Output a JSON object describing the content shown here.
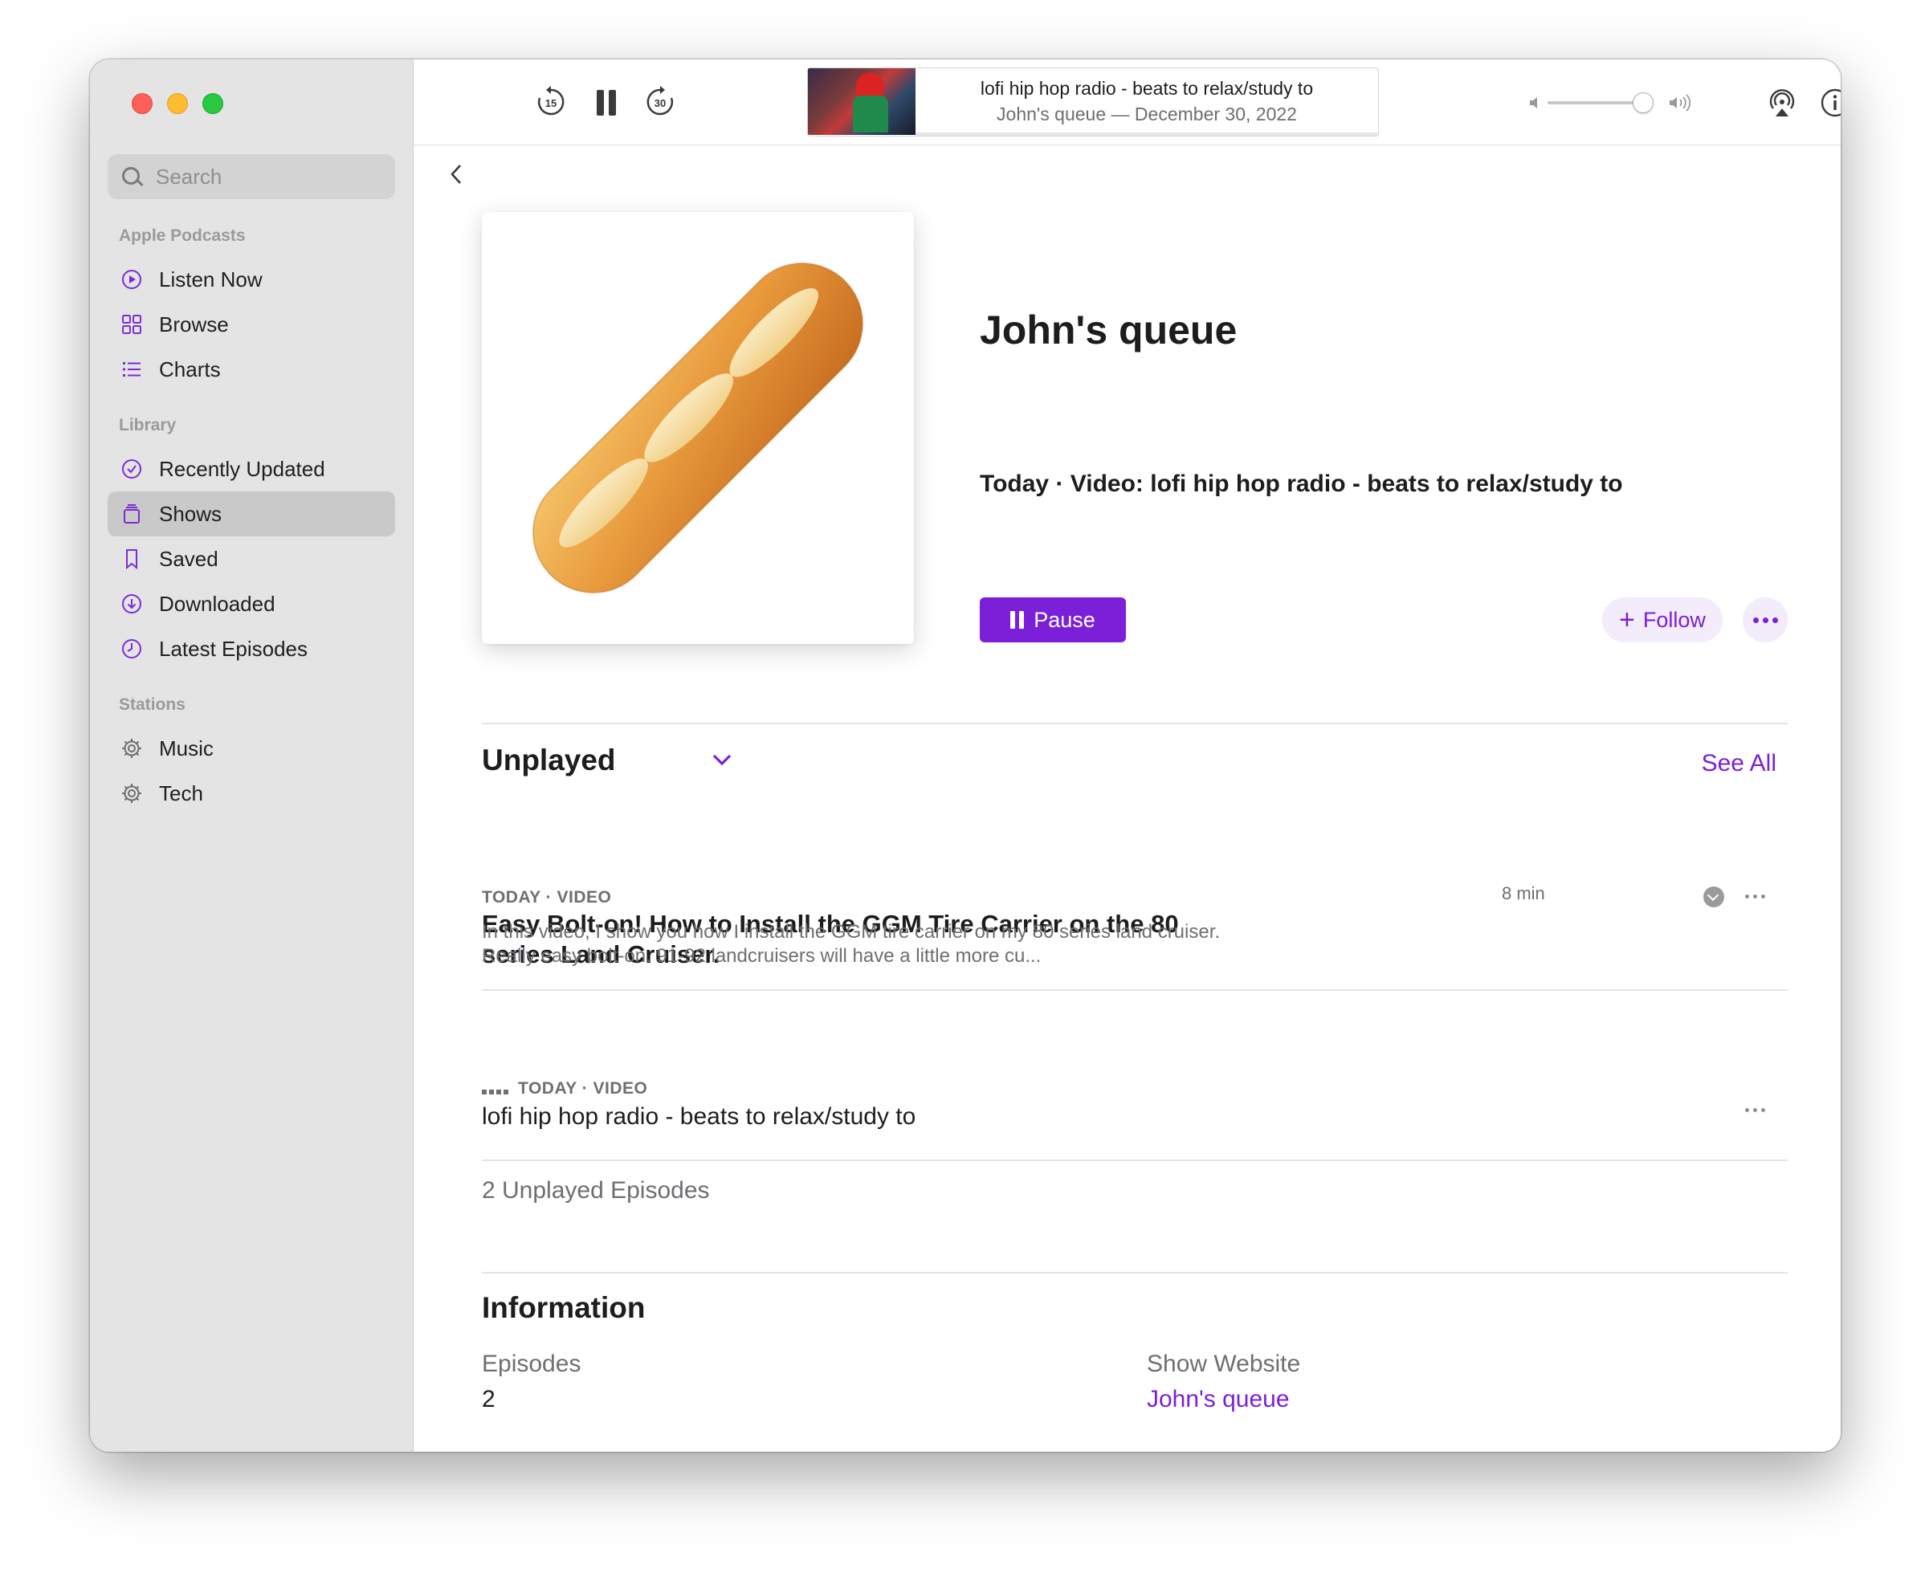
{
  "colors": {
    "accent": "#7b1fd9",
    "sidebar_bg": "#e4e4e4",
    "selected_bg": "#c9c9c9"
  },
  "sidebar": {
    "search_placeholder": "Search",
    "sections": [
      {
        "label": "Apple Podcasts",
        "items": [
          {
            "label": "Listen Now",
            "icon": "play-circle-icon"
          },
          {
            "label": "Browse",
            "icon": "grid-icon"
          },
          {
            "label": "Charts",
            "icon": "list-icon"
          }
        ]
      },
      {
        "label": "Library",
        "items": [
          {
            "label": "Recently Updated",
            "icon": "check-circle-icon"
          },
          {
            "label": "Shows",
            "icon": "stack-icon",
            "selected": true
          },
          {
            "label": "Saved",
            "icon": "bookmark-icon"
          },
          {
            "label": "Downloaded",
            "icon": "download-circle-icon"
          },
          {
            "label": "Latest Episodes",
            "icon": "clock-icon"
          }
        ]
      },
      {
        "label": "Stations",
        "items": [
          {
            "label": "Music",
            "icon": "gear-icon"
          },
          {
            "label": "Tech",
            "icon": "gear-icon"
          }
        ]
      }
    ]
  },
  "toolbar": {
    "skip_back_seconds": "15",
    "skip_forward_seconds": "30",
    "now_playing": {
      "title": "lofi hip hop radio - beats to relax/study to",
      "subtitle": "John's queue — December 30, 2022"
    }
  },
  "show": {
    "title": "John's queue",
    "subtitle": "Today · Video: lofi hip hop radio - beats to relax/study to",
    "pause_label": "Pause",
    "follow_label": "Follow"
  },
  "unplayed": {
    "title": "Unplayed",
    "see_all": "See All",
    "episodes": [
      {
        "meta": "TODAY · VIDEO",
        "title": "Easy Bolt-on! How to Install the GGM Tire Carrier on the 80 series Land Cruiser.",
        "description": "In this video, I show you how I install the GGM tire carrier on my 80 series land cruiser. Really easy bolt-on. 91-92 landcruisers will have a little more cu...",
        "duration": "8 min"
      },
      {
        "meta": "TODAY · VIDEO",
        "title": "lofi hip hop radio - beats to relax/study to"
      }
    ],
    "count_label": "2 Unplayed Episodes"
  },
  "information": {
    "title": "Information",
    "episodes_label": "Episodes",
    "episodes_value": "2",
    "website_label": "Show Website",
    "website_value": "John's queue"
  }
}
